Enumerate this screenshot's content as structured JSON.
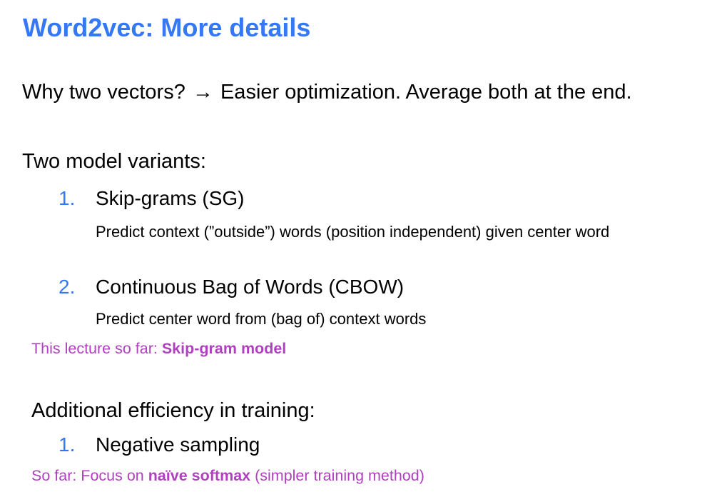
{
  "slide": {
    "title": "Word2vec: More details",
    "why": {
      "question": "Why two vectors?",
      "arrow": "→",
      "answer": "Easier optimization. Average both at the end."
    },
    "variants": {
      "heading": "Two model variants:",
      "items": [
        {
          "number": "1.",
          "label": "Skip-grams (SG)",
          "description": "Predict context (”outside”) words (position independent) given center word"
        },
        {
          "number": "2.",
          "label": "Continuous Bag of Words (CBOW)",
          "description": "Predict center word from (bag of) context words"
        }
      ]
    },
    "note_lecture": {
      "prefix": "This lecture so far: ",
      "emphasis": "Skip-gram model"
    },
    "efficiency": {
      "heading": "Additional efficiency in training:",
      "items": [
        {
          "number": "1.",
          "label": "Negative sampling"
        }
      ]
    },
    "note_softmax": {
      "prefix": "So far: Focus on ",
      "emphasis": "naïve softmax",
      "suffix": " (simpler training method)"
    }
  },
  "colors": {
    "title": "#3478f6",
    "list_number": "#3478f6",
    "note": "#b040c0",
    "text": "#000000"
  }
}
